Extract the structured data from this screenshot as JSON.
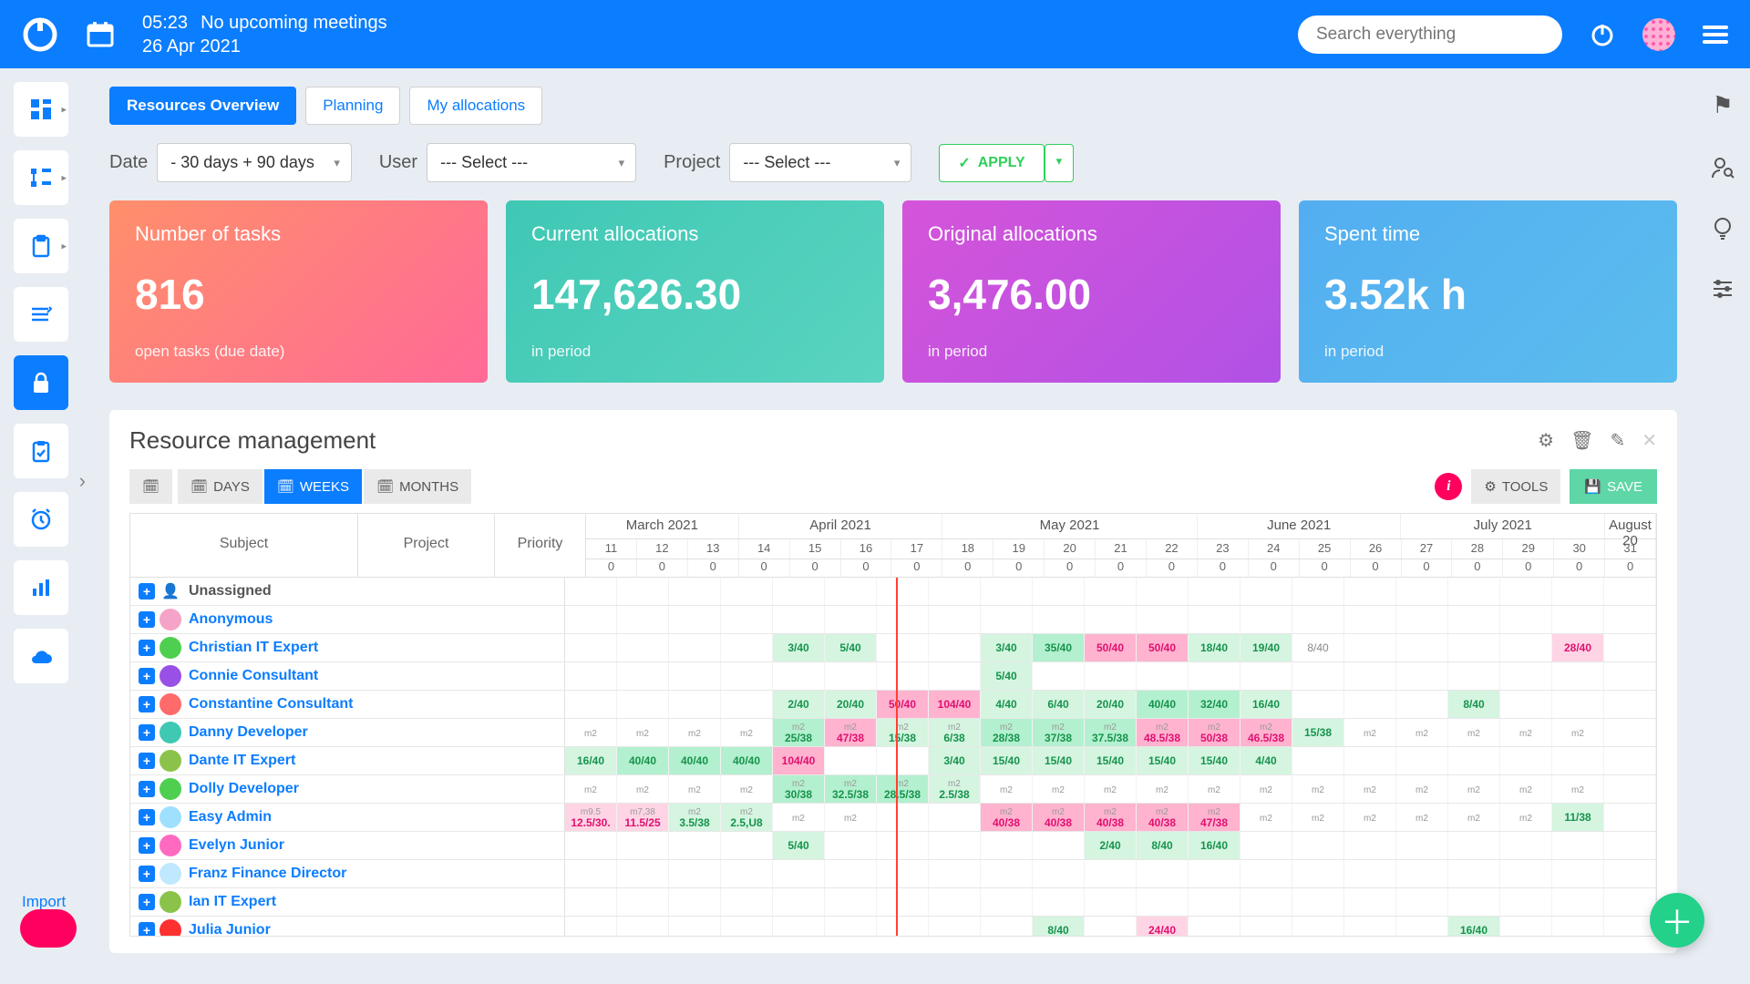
{
  "topbar": {
    "time": "05:23",
    "status": "No upcoming meetings",
    "date": "26 Apr 2021",
    "search_placeholder": "Search everything"
  },
  "tabs": [
    {
      "label": "Resources Overview",
      "active": true
    },
    {
      "label": "Planning"
    },
    {
      "label": "My allocations"
    }
  ],
  "filters": {
    "date_label": "Date",
    "date_value": "- 30 days + 90 days",
    "user_label": "User",
    "user_value": "--- Select ---",
    "project_label": "Project",
    "project_value": "--- Select ---",
    "apply": "APPLY"
  },
  "cards": [
    {
      "title": "Number of tasks",
      "value": "816",
      "sub": "open tasks (due date)"
    },
    {
      "title": "Current allocations",
      "value": "147,626.30",
      "sub": "in period"
    },
    {
      "title": "Original allocations",
      "value": "3,476.00",
      "sub": "in period"
    },
    {
      "title": "Spent time",
      "value": "3.52k h",
      "sub": "in period"
    }
  ],
  "panel": {
    "title": "Resource management",
    "days": "DAYS",
    "weeks": "WEEKS",
    "months": "MONTHS",
    "tools": "TOOLS",
    "save": "SAVE"
  },
  "gridhead": {
    "subject": "Subject",
    "project": "Project",
    "priority": "Priority"
  },
  "months": [
    {
      "label": "March 2021",
      "span": 3
    },
    {
      "label": "April 2021",
      "span": 4
    },
    {
      "label": "May 2021",
      "span": 5
    },
    {
      "label": "June 2021",
      "span": 4
    },
    {
      "label": "July 2021",
      "span": 4
    },
    {
      "label": "August 20",
      "span": 1
    }
  ],
  "weeks": [
    "11",
    "12",
    "13",
    "14",
    "15",
    "16",
    "17",
    "18",
    "19",
    "20",
    "21",
    "22",
    "23",
    "24",
    "25",
    "26",
    "27",
    "28",
    "29",
    "30",
    "31"
  ],
  "rows": [
    {
      "name": "Unassigned",
      "color": "#777",
      "unassigned": true,
      "cells": [
        "",
        "",
        "",
        "",
        "",
        "",
        "",
        "",
        "",
        "",
        "",
        "",
        "",
        "",
        "",
        "",
        "",
        "",
        "",
        "",
        ""
      ]
    },
    {
      "name": "Anonymous",
      "color": "#f5a3c7",
      "cells": [
        "",
        "",
        "",
        "",
        "",
        "",
        "",
        "",
        "",
        "",
        "",
        "",
        "",
        "",
        "",
        "",
        "",
        "",
        "",
        "",
        ""
      ]
    },
    {
      "name": "Christian IT Expert",
      "color": "#4fcf4f",
      "cells": [
        "",
        "",
        "",
        "",
        {
          "t": "3/40",
          "c": "lgreen"
        },
        {
          "t": "5/40",
          "c": "lgreen"
        },
        "",
        "",
        {
          "t": "3/40",
          "c": "lgreen"
        },
        {
          "t": "35/40",
          "c": "green"
        },
        {
          "t": "50/40",
          "c": "pink"
        },
        {
          "t": "50/40",
          "c": "pink"
        },
        {
          "t": "18/40",
          "c": "lgreen"
        },
        {
          "t": "19/40",
          "c": "lgreen"
        },
        {
          "t": "8/40",
          "c": "grey"
        },
        "",
        "",
        "",
        "",
        {
          "t": "28/40",
          "c": "lpink"
        },
        ""
      ]
    },
    {
      "name": "Connie Consultant",
      "color": "#9950e6",
      "cells": [
        "",
        "",
        "",
        "",
        "",
        "",
        "",
        "",
        {
          "t": "5/40",
          "c": "lgreen"
        },
        "",
        "",
        "",
        "",
        "",
        "",
        "",
        "",
        "",
        "",
        "",
        ""
      ]
    },
    {
      "name": "Constantine Consultant",
      "color": "#ff6a6a",
      "cells": [
        "",
        "",
        "",
        "",
        {
          "t": "2/40",
          "c": "lgreen"
        },
        {
          "t": "20/40",
          "c": "lgreen"
        },
        {
          "t": "50/40",
          "c": "pink"
        },
        {
          "t": "104/40",
          "c": "pink"
        },
        {
          "t": "4/40",
          "c": "lgreen"
        },
        {
          "t": "6/40",
          "c": "lgreen"
        },
        {
          "t": "20/40",
          "c": "lgreen"
        },
        {
          "t": "40/40",
          "c": "green"
        },
        {
          "t": "32/40",
          "c": "green"
        },
        {
          "t": "16/40",
          "c": "lgreen"
        },
        "",
        "",
        "",
        {
          "t": "8/40",
          "c": "lgreen"
        },
        "",
        "",
        ""
      ]
    },
    {
      "name": "Danny Developer",
      "color": "#3fc8b4",
      "cells": [
        {
          "m": "m2"
        },
        {
          "m": "m2"
        },
        {
          "m": "m2"
        },
        {
          "m": "m2"
        },
        {
          "t": "25/38",
          "c": "green",
          "m": "m2"
        },
        {
          "t": "47/38",
          "c": "pink",
          "m": "m2"
        },
        {
          "t": "15/38",
          "c": "lgreen",
          "m": "m2"
        },
        {
          "t": "6/38",
          "c": "lgreen",
          "m": "m2"
        },
        {
          "t": "28/38",
          "c": "green",
          "m": "m2"
        },
        {
          "t": "37/38",
          "c": "green",
          "m": "m2"
        },
        {
          "t": "37.5/38",
          "c": "green",
          "m": "m2"
        },
        {
          "t": "48.5/38",
          "c": "pink",
          "m": "m2"
        },
        {
          "t": "50/38",
          "c": "pink",
          "m": "m2"
        },
        {
          "t": "46.5/38",
          "c": "pink",
          "m": "m2"
        },
        {
          "t": "15/38",
          "c": "lgreen"
        },
        {
          "m": "m2"
        },
        {
          "m": "m2"
        },
        {
          "m": "m2"
        },
        {
          "m": "m2"
        },
        {
          "m": "m2"
        },
        ""
      ]
    },
    {
      "name": "Dante IT Expert",
      "color": "#8bc34a",
      "cells": [
        {
          "t": "16/40",
          "c": "lgreen"
        },
        {
          "t": "40/40",
          "c": "green"
        },
        {
          "t": "40/40",
          "c": "green"
        },
        {
          "t": "40/40",
          "c": "green"
        },
        {
          "t": "104/40",
          "c": "pink"
        },
        "",
        "",
        {
          "t": "3/40",
          "c": "lgreen"
        },
        {
          "t": "15/40",
          "c": "lgreen"
        },
        {
          "t": "15/40",
          "c": "lgreen"
        },
        {
          "t": "15/40",
          "c": "lgreen"
        },
        {
          "t": "15/40",
          "c": "lgreen"
        },
        {
          "t": "15/40",
          "c": "lgreen"
        },
        {
          "t": "4/40",
          "c": "lgreen"
        },
        "",
        "",
        "",
        "",
        "",
        "",
        ""
      ]
    },
    {
      "name": "Dolly Developer",
      "color": "#4fcf4f",
      "cells": [
        {
          "m": "m2"
        },
        {
          "m": "m2"
        },
        {
          "m": "m2"
        },
        {
          "m": "m2"
        },
        {
          "t": "30/38",
          "c": "green",
          "m": "m2"
        },
        {
          "t": "32.5/38",
          "c": "green",
          "m": "m2"
        },
        {
          "t": "28.5/38",
          "c": "green",
          "m": "m2"
        },
        {
          "t": "2.5/38",
          "c": "lgreen",
          "m": "m2"
        },
        {
          "m": "m2"
        },
        {
          "m": "m2"
        },
        {
          "m": "m2"
        },
        {
          "m": "m2"
        },
        {
          "m": "m2"
        },
        {
          "m": "m2"
        },
        {
          "m": "m2"
        },
        {
          "m": "m2"
        },
        {
          "m": "m2"
        },
        {
          "m": "m2"
        },
        {
          "m": "m2"
        },
        {
          "m": "m2"
        },
        ""
      ]
    },
    {
      "name": "Easy Admin",
      "color": "#a0e0ff",
      "cells": [
        {
          "t": "12.5/30.",
          "c": "lpink",
          "m": "m9.5"
        },
        {
          "t": "11.5/25",
          "c": "lpink",
          "m": "m7,38"
        },
        {
          "t": "3.5/38",
          "c": "lgreen",
          "m": "m2"
        },
        {
          "t": "2.5,U8",
          "c": "lgreen",
          "m": "m2"
        },
        {
          "m": "m2"
        },
        {
          "m": "m2"
        },
        "",
        "",
        {
          "t": "40/38",
          "c": "pink",
          "m": "m2"
        },
        {
          "t": "40/38",
          "c": "pink",
          "m": "m2"
        },
        {
          "t": "40/38",
          "c": "pink",
          "m": "m2"
        },
        {
          "t": "40/38",
          "c": "pink",
          "m": "m2"
        },
        {
          "t": "47/38",
          "c": "pink",
          "m": "m2"
        },
        {
          "m": "m2"
        },
        {
          "m": "m2"
        },
        {
          "m": "m2"
        },
        {
          "m": "m2"
        },
        {
          "m": "m2"
        },
        {
          "m": "m2"
        },
        {
          "t": "11/38",
          "c": "lgreen"
        },
        ""
      ]
    },
    {
      "name": "Evelyn Junior",
      "color": "#ff6ac0",
      "cells": [
        "",
        "",
        "",
        "",
        {
          "t": "5/40",
          "c": "lgreen"
        },
        "",
        "",
        "",
        "",
        "",
        {
          "t": "2/40",
          "c": "lgreen"
        },
        {
          "t": "8/40",
          "c": "lgreen"
        },
        {
          "t": "16/40",
          "c": "lgreen"
        },
        "",
        "",
        "",
        "",
        "",
        "",
        "",
        ""
      ]
    },
    {
      "name": "Franz Finance Director",
      "color": "#c0e8ff",
      "cells": [
        "",
        "",
        "",
        "",
        "",
        "",
        "",
        "",
        "",
        "",
        "",
        "",
        "",
        "",
        "",
        "",
        "",
        "",
        "",
        "",
        ""
      ]
    },
    {
      "name": "Ian IT Expert",
      "color": "#8bc34a",
      "cells": [
        "",
        "",
        "",
        "",
        "",
        "",
        "",
        "",
        "",
        "",
        "",
        "",
        "",
        "",
        "",
        "",
        "",
        "",
        "",
        "",
        ""
      ]
    },
    {
      "name": "Julia Junior",
      "color": "#ff3030",
      "cells": [
        "",
        "",
        "",
        "",
        "",
        "",
        "",
        "",
        "",
        {
          "t": "8/40",
          "c": "lgreen"
        },
        "",
        {
          "t": "24/40",
          "c": "lpink"
        },
        "",
        "",
        "",
        "",
        "",
        {
          "t": "16/40",
          "c": "lgreen"
        },
        "",
        "",
        ""
      ]
    }
  ],
  "import": "Import"
}
